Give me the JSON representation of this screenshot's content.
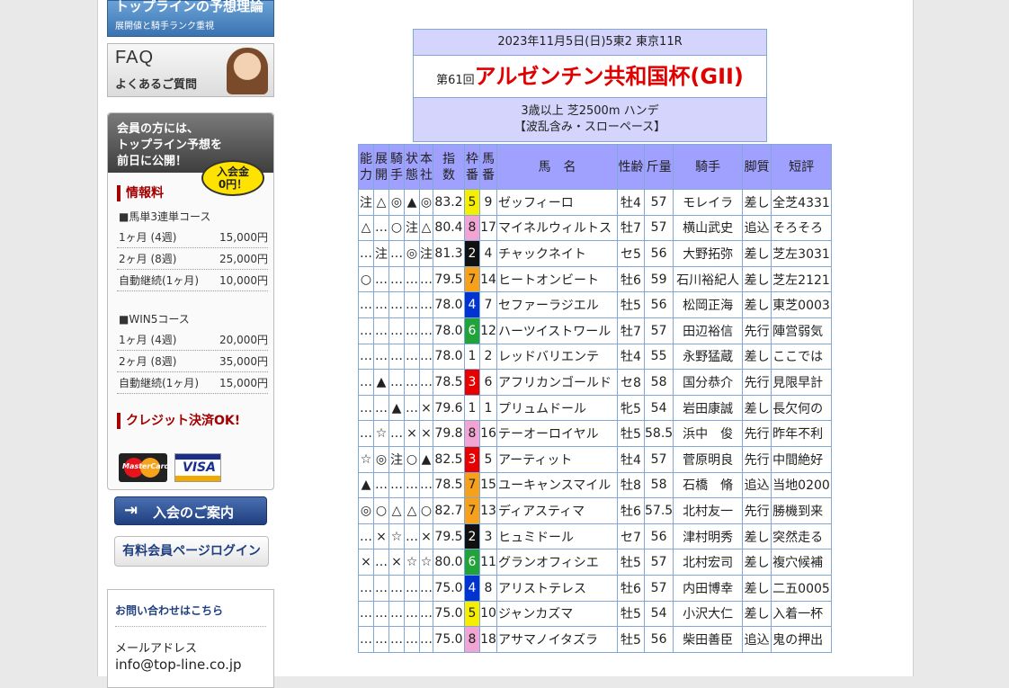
{
  "sidebar": {
    "top_banner": {
      "title": "トップラインの予想理論",
      "sub": "展開値と騎手ランク重視"
    },
    "faq_banner": {
      "title": "FAQ",
      "sub": "よくあるご質問"
    },
    "member_panel": {
      "head_lines": [
        "会員の方には、",
        "トップライン予想を",
        "前日に公開！"
      ],
      "bubble": [
        "入会金",
        "0円！"
      ],
      "fee_title": "情報料",
      "course1": "■馬単3連単コース",
      "course1_prices": [
        {
          "label": "1ヶ月 (4週)",
          "price": "15,000円"
        },
        {
          "label": "2ヶ月 (8週)",
          "price": "25,000円"
        },
        {
          "label": "自動継続(1ヶ月)",
          "price": "10,000円"
        }
      ],
      "course2": "■WIN5コース",
      "course2_prices": [
        {
          "label": "1ヶ月 (4週)",
          "price": "20,000円"
        },
        {
          "label": "2ヶ月 (8週)",
          "price": "35,000円"
        },
        {
          "label": "自動継続(1ヶ月)",
          "price": "15,000円"
        }
      ],
      "credit_title": "クレジット決済OK!",
      "card1": "MasterCard",
      "card2": "VISA"
    },
    "join_button": "入会のご案内",
    "login_button": "有料会員ページログイン",
    "contact": {
      "title": "お問い合わせはこちら",
      "mail_label": "メールアドレス",
      "mail": "info@top-line.co.jp"
    }
  },
  "race": {
    "date_line": "2023年11月5日(日)5東2 東京11R",
    "edition": "第61回",
    "name": "アルゼンチン共和国杯(GII)",
    "condition": "3歳以上 芝2500m ハンデ",
    "forecast": "【波乱含み・スローペース】"
  },
  "table": {
    "headers": [
      [
        "能",
        "力"
      ],
      [
        "展",
        "開"
      ],
      [
        "騎",
        "手"
      ],
      [
        "状",
        "態"
      ],
      [
        "本",
        "社"
      ],
      [
        "指",
        "数"
      ],
      [
        "枠",
        "番"
      ],
      [
        "馬",
        "番"
      ],
      [
        "馬　名"
      ],
      [
        "性齢"
      ],
      [
        "斤量"
      ],
      [
        "騎手"
      ],
      [
        "脚質"
      ],
      [
        "短評"
      ]
    ],
    "rows": [
      [
        "注",
        "△",
        "◎",
        "▲",
        "◎",
        "83.2",
        "5",
        "9",
        "ゼッフィーロ",
        "牡4",
        "57",
        "モレイラ",
        "差し",
        "全芝4331"
      ],
      [
        "△",
        "…",
        "○",
        "注",
        "△",
        "80.4",
        "8",
        "17",
        "マイネルウィルトス",
        "牡7",
        "57",
        "横山武史",
        "追込",
        "そろそろ"
      ],
      [
        "…",
        "注",
        "…",
        "◎",
        "注",
        "81.3",
        "2",
        "4",
        "チャックネイト",
        "セ5",
        "56",
        "大野拓弥",
        "差し",
        "芝左3031"
      ],
      [
        "○",
        "…",
        "…",
        "…",
        "…",
        "79.5",
        "7",
        "14",
        "ヒートオンビート",
        "牡6",
        "59",
        "石川裕紀人",
        "差し",
        "芝左2121"
      ],
      [
        "…",
        "…",
        "…",
        "…",
        "…",
        "78.0",
        "4",
        "7",
        "セファーラジエル",
        "牡5",
        "56",
        "松岡正海",
        "差し",
        "東芝0003"
      ],
      [
        "…",
        "…",
        "…",
        "…",
        "…",
        "78.0",
        "6",
        "12",
        "ハーツイストワール",
        "牡7",
        "57",
        "田辺裕信",
        "先行",
        "陣営弱気"
      ],
      [
        "…",
        "…",
        "…",
        "…",
        "…",
        "78.0",
        "1",
        "2",
        "レッドバリエンテ",
        "牡4",
        "55",
        "永野猛蔵",
        "差し",
        "ここでは"
      ],
      [
        "…",
        "▲",
        "…",
        "…",
        "…",
        "78.5",
        "3",
        "6",
        "アフリカンゴールド",
        "セ8",
        "58",
        "国分恭介",
        "先行",
        "見限早計"
      ],
      [
        "…",
        "…",
        "▲",
        "…",
        "×",
        "79.6",
        "1",
        "1",
        "プリュムドール",
        "牝5",
        "54",
        "岩田康誠",
        "差し",
        "長欠何の"
      ],
      [
        "…",
        "☆",
        "…",
        "×",
        "×",
        "79.8",
        "8",
        "16",
        "テーオーロイヤル",
        "牡5",
        "58.5",
        "浜中　俊",
        "先行",
        "昨年不利"
      ],
      [
        "☆",
        "◎",
        "注",
        "○",
        "▲",
        "82.5",
        "3",
        "5",
        "アーティット",
        "牡4",
        "57",
        "菅原明良",
        "先行",
        "中間絶好"
      ],
      [
        "▲",
        "…",
        "…",
        "…",
        "…",
        "78.5",
        "7",
        "15",
        "ユーキャンスマイル",
        "牡8",
        "58",
        "石橋　脩",
        "追込",
        "当地0200"
      ],
      [
        "◎",
        "○",
        "△",
        "△",
        "○",
        "82.7",
        "7",
        "13",
        "ディアスティマ",
        "牡6",
        "57.5",
        "北村友一",
        "先行",
        "勝機到来"
      ],
      [
        "…",
        "×",
        "☆",
        "…",
        "×",
        "79.5",
        "2",
        "3",
        "ヒュミドール",
        "セ7",
        "56",
        "津村明秀",
        "差し",
        "突然走る"
      ],
      [
        "×",
        "…",
        "×",
        "☆",
        "☆",
        "80.0",
        "6",
        "11",
        "グランオフィシエ",
        "牡5",
        "57",
        "北村宏司",
        "差し",
        "複穴候補"
      ],
      [
        "…",
        "…",
        "…",
        "…",
        "…",
        "75.0",
        "4",
        "8",
        "アリストテレス",
        "牡6",
        "57",
        "内田博幸",
        "差し",
        "二五0005"
      ],
      [
        "…",
        "…",
        "…",
        "…",
        "…",
        "75.0",
        "5",
        "10",
        "ジャンカズマ",
        "牡5",
        "54",
        "小沢大仁",
        "差し",
        "入着一杯"
      ],
      [
        "…",
        "…",
        "…",
        "…",
        "…",
        "75.0",
        "8",
        "18",
        "アサマノイタズラ",
        "牡5",
        "56",
        "柴田善臣",
        "追込",
        "鬼の押出"
      ]
    ]
  },
  "colors": {
    "header_bg": "#a0a0fe",
    "race_band": "#d4d4fc",
    "race_name": "#e00000"
  }
}
